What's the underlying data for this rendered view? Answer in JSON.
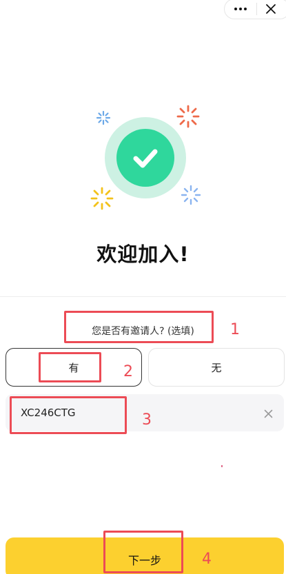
{
  "capsule": {
    "more_icon": "more-dots-icon",
    "close_icon": "close-icon"
  },
  "hero": {
    "badge_icon": "check-circle-icon",
    "title": "欢迎加入!",
    "colors": {
      "badge_ring": "#cdf1e3",
      "badge_core": "#2fd79c",
      "sparkle_blue": "#6aa8e8",
      "sparkle_red": "#ee6a4a",
      "sparkle_yellow": "#f3c21b",
      "sparkle_lavender": "#8ab4f0"
    }
  },
  "form": {
    "question": "您是否有邀请人? (选填)",
    "options": [
      {
        "label": "有",
        "selected": true
      },
      {
        "label": "无",
        "selected": false
      }
    ],
    "inviter_code": {
      "value": "XC246CTG",
      "clear_icon": "clear-x-icon"
    }
  },
  "footer": {
    "next_label": "下一步",
    "accent": "#fcd02f"
  },
  "annotations": [
    {
      "number": "1"
    },
    {
      "number": "2"
    },
    {
      "number": "3"
    },
    {
      "number": "4"
    }
  ]
}
